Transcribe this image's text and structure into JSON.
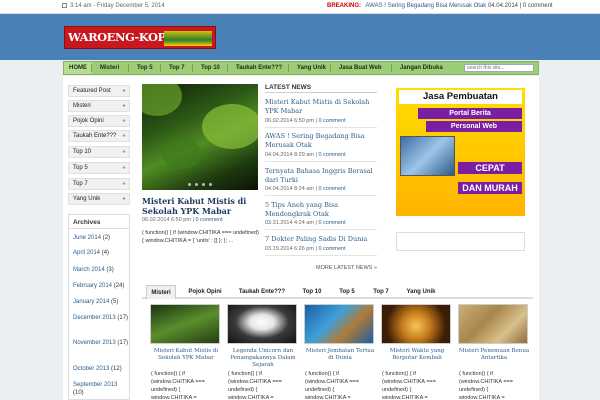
{
  "topbar": {
    "date": "3:14 am - Friday December 5, 2014",
    "breaking_label": "BREAKING:",
    "breaking_title": "AWAS ! Sering Begadang Bisa Merusak Otak",
    "breaking_date": "04.04.2014",
    "breaking_comments": "0 comment"
  },
  "header": {
    "logo_text": "WAROENG-KOPI.COM"
  },
  "nav": {
    "items": [
      "HOME",
      "Misteri",
      "Top 5",
      "Top 7",
      "Top 10",
      "Taukah Ente???",
      "Yang Unik",
      "Jasa Buat Web",
      "Jangan Dibuka"
    ],
    "search_placeholder": "search this site..."
  },
  "sidebar": {
    "categories": [
      "Featured Post",
      "Misteri",
      "Pojok Opini",
      "Taukah Ente???",
      "Top 10",
      "Top 5",
      "Top 7",
      "Yang Unik"
    ],
    "archives_title": "Archives",
    "archives": [
      {
        "label": "June 2014",
        "count": "(2)"
      },
      {
        "label": "April 2014",
        "count": "(4)"
      },
      {
        "label": "March 2014",
        "count": "(3)"
      },
      {
        "label": "February 2014",
        "count": "(24)"
      },
      {
        "label": "January 2014",
        "count": "(5)"
      },
      {
        "label": "December 2013",
        "count": "(17)"
      },
      {
        "label": "November 2013",
        "count": "(17)"
      },
      {
        "label": "October 2013",
        "count": "(12)"
      },
      {
        "label": "September 2013",
        "count": "(10)"
      }
    ]
  },
  "featured": {
    "title": "Misteri Kabut Mistis di Sekolah YPK Mabar",
    "date": "06.02.2014 6:50 pm",
    "comments": "0 comment",
    "excerpt": "( function() { if (window.CHITIKA === undefined) { window.CHITIKA = { 'units' : [] }; }; ..."
  },
  "latest_news": {
    "title": "LATEST NEWS",
    "items": [
      {
        "title": "Misteri Kabut Mistis di Sekolah YPK Mabar",
        "date": "06.02.2014 6:50 pm",
        "comments": "0 comment"
      },
      {
        "title": "AWAS ! Sering Begadang Bisa Merusak Otak",
        "date": "04.04.2014 8:29 am",
        "comments": "0 comment"
      },
      {
        "title": "Ternyata Bahasa Inggris Berasal dari Turki",
        "date": "04.04.2014 8:24 am",
        "comments": "0 comment"
      },
      {
        "title": "5 Tips Aneh yang Bisa Mendongkrak Otak",
        "date": "03.31.2014 4:24 am",
        "comments": "0 comment"
      },
      {
        "title": "7 Dokter Paling Sadis Di Dunia",
        "date": "03.19.2014 6:26 pm",
        "comments": "0 comment"
      }
    ],
    "more": "MORE LATEST NEWS »"
  },
  "ad": {
    "line1": "Jasa Pembuatan",
    "line2": "Portal Berita",
    "line3": "Personal Web",
    "line4": "CEPAT",
    "line5": "DAN MURAH"
  },
  "tabs": {
    "items": [
      "Misteri",
      "Pojok Opini",
      "Taukah Ente???",
      "Top 10",
      "Top 5",
      "Top 7",
      "Yang Unik"
    ],
    "active": "Misteri",
    "posts": [
      {
        "title": "Misteri Kabut Mistis di Sekolah YPK Mabar",
        "excerpt": "( function() { if (window.CHITIKA === undefined) { window.CHITIKA ="
      },
      {
        "title": "Legenda Unicorn dan Penampakannya Dalam Sejarah",
        "excerpt": "( function() { if (window.CHITIKA === undefined) { window.CHITIKA ="
      },
      {
        "title": "Misteri Jembatan Tertua di Dunia",
        "excerpt": "( function() { if (window.CHITIKA === undefined) { window.CHITIKA ="
      },
      {
        "title": "Misteri Waktu yang Berputar Kembali",
        "excerpt": "( function() { if (window.CHITIKA === undefined) { window.CHITIKA ="
      },
      {
        "title": "Misteri Penemuan Benua Antartika",
        "excerpt": "( function() { if (window.CHITIKA === undefined) { window.CHITIKA ="
      }
    ]
  }
}
